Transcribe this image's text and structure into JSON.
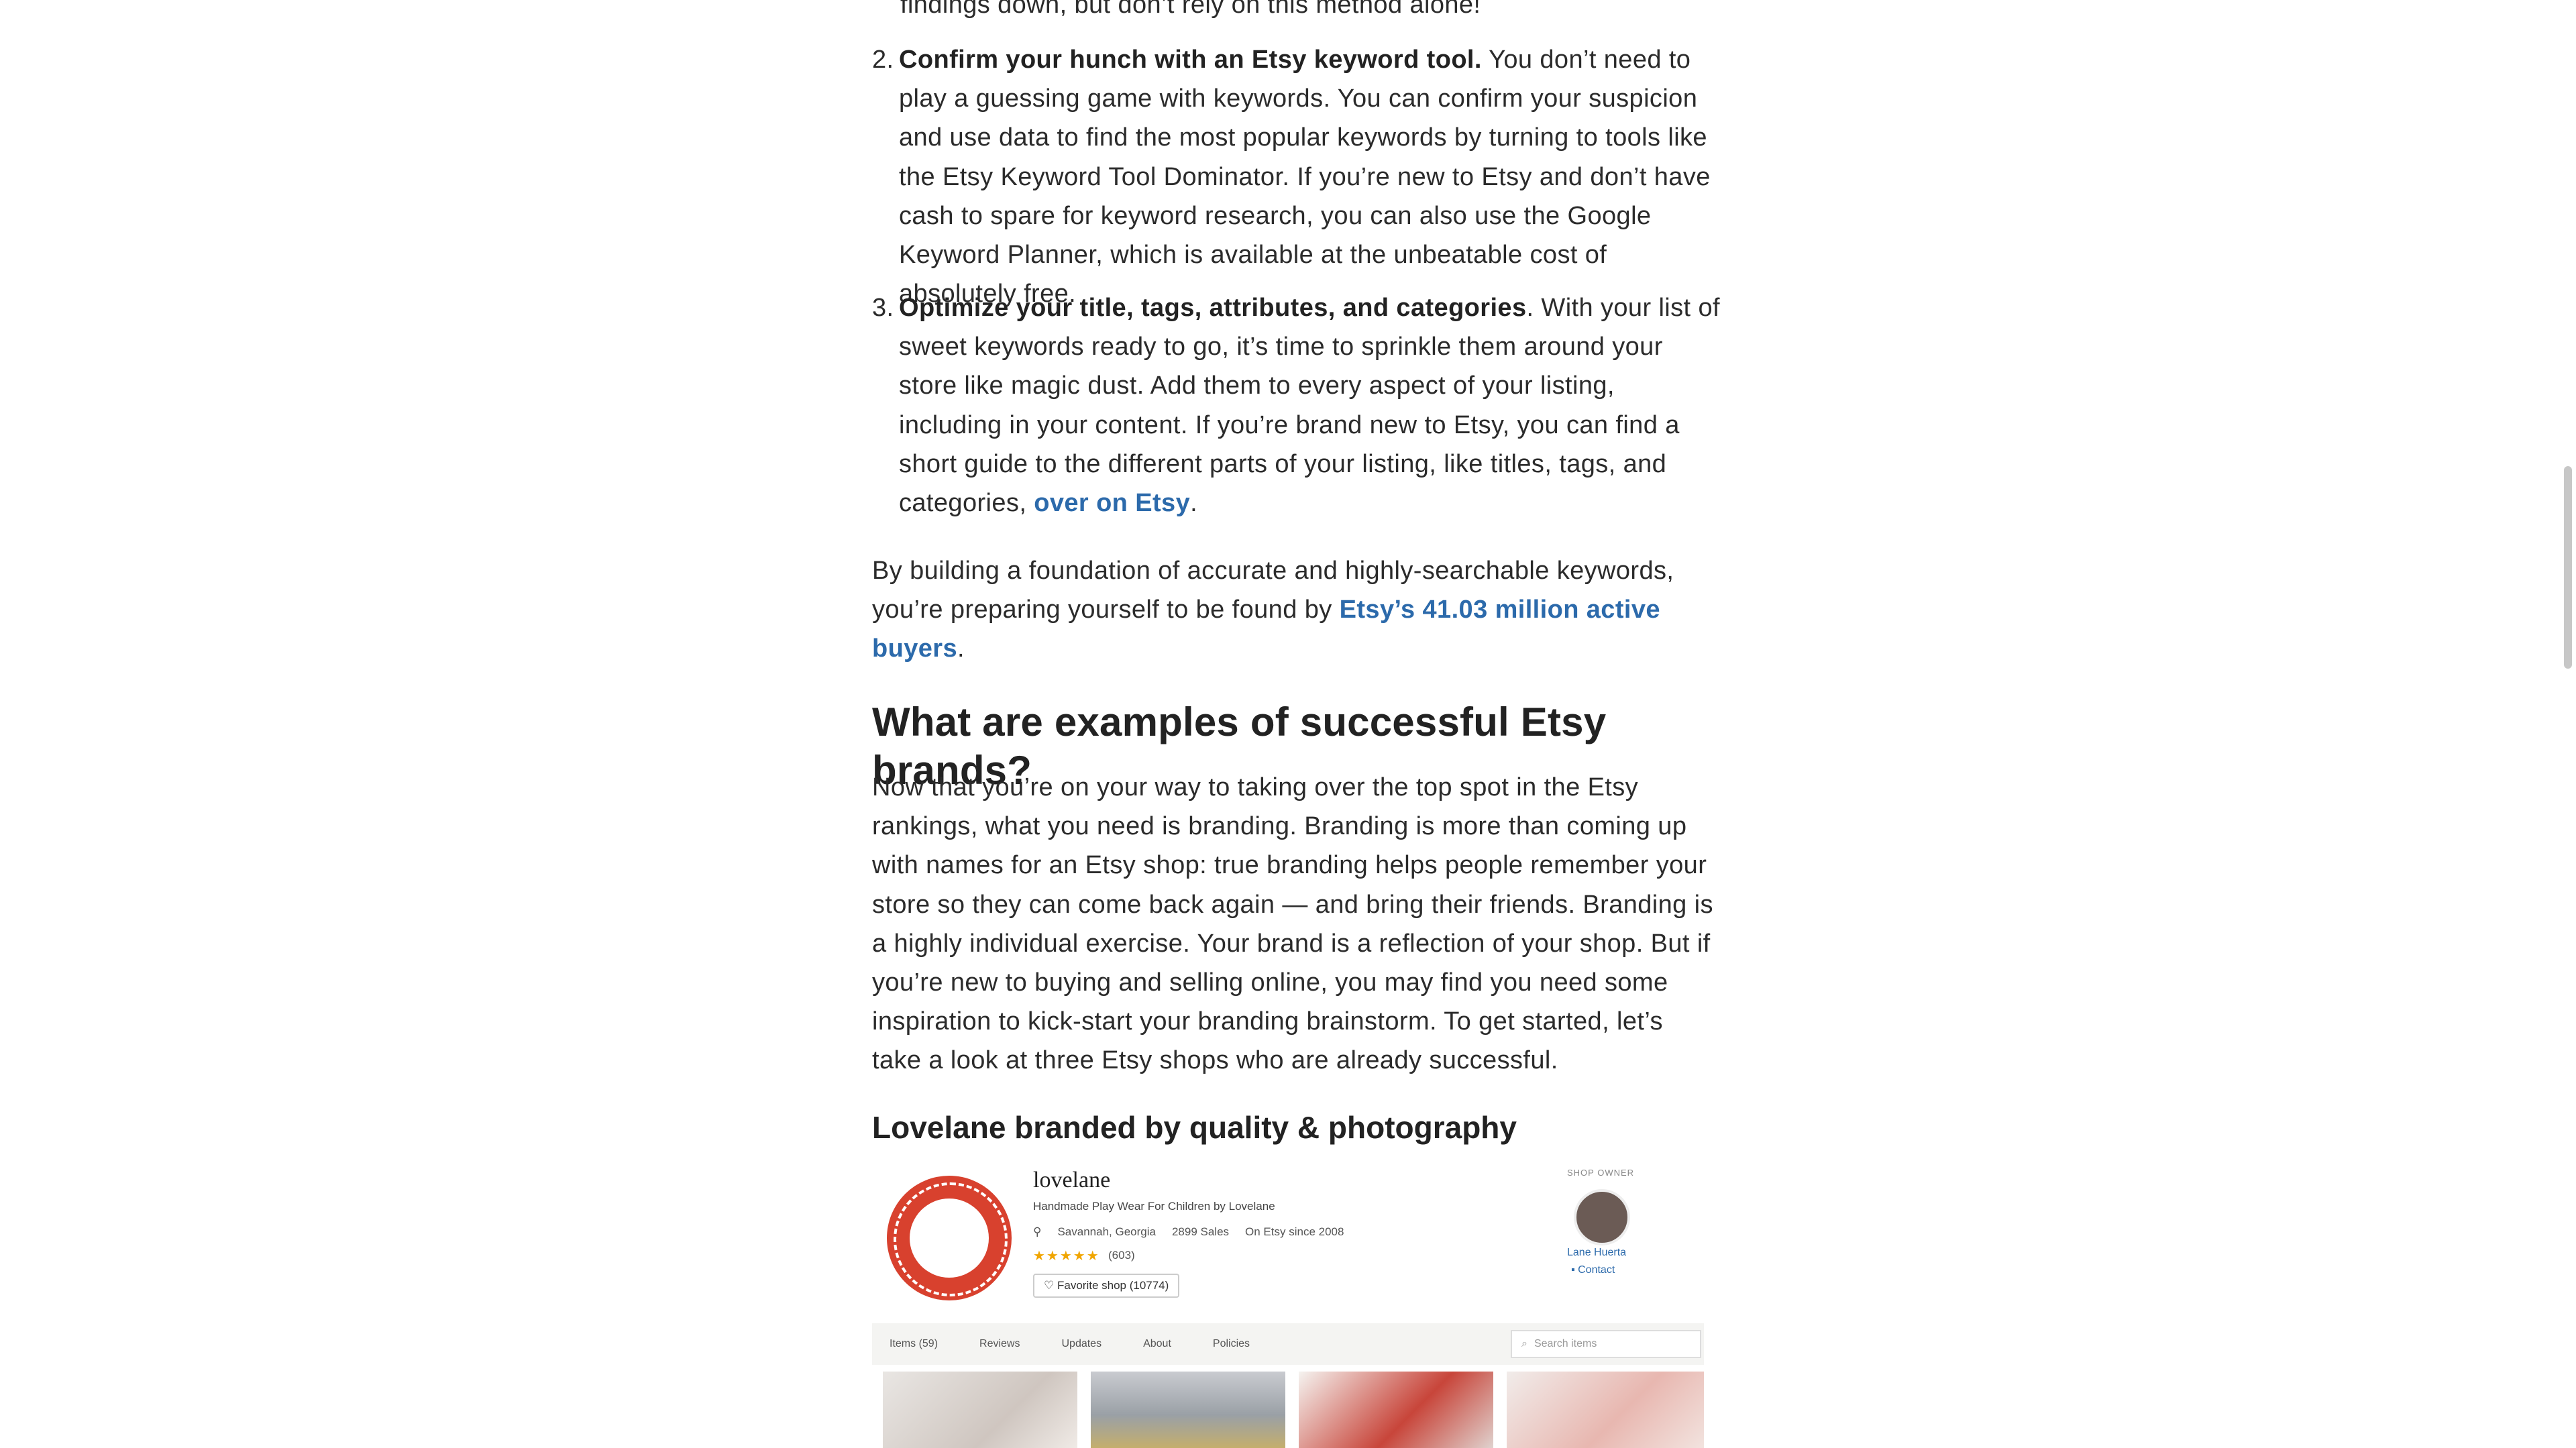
{
  "article": {
    "top_fragment": "findings down, but don’t rely on this method alone!",
    "list": [
      {
        "number": "2.",
        "bold": "Confirm your hunch with an Etsy keyword tool.",
        "text": " You don’t need to play a guessing game with keywords. You can confirm your suspicion and use data to find the most popular keywords by turning to tools like the Etsy Keyword Tool Dominator. If you’re new to Etsy and don’t have cash to spare for keyword research, you can also use the Google Keyword Planner, which is available at the unbeatable cost of absolutely free."
      },
      {
        "number": "3.",
        "bold": "Optimize your title, tags, attributes, and categories",
        "text": ". With your list of sweet keywords ready to go, it’s time to sprinkle them around your store like magic dust. Add them to every aspect of your listing, including in your content. If you’re brand new to Etsy, you can find a short guide to the different parts of your listing, like titles, tags, and categories, ",
        "link": "over on Etsy",
        "tail": "."
      }
    ],
    "para1": {
      "text": "By building a foundation of accurate and highly-searchable keywords, you’re preparing yourself to be found by ",
      "link": "Etsy’s 41.03 million active buyers",
      "tail": "."
    },
    "heading": "What are examples of successful Etsy brands?",
    "para2": "Now that you’re on your way to taking over the top spot in the Etsy rankings, what you need is branding. Branding is more than coming up with names for an Etsy shop: true branding helps people remember your store so they can come back again — and bring their friends. Branding is a highly individual exercise. Your brand is a reflection of your shop. But if you’re new to buying and selling online, you may find you need some inspiration to kick-start your branding brainstorm. To get started, let’s take a look at three Etsy shops who are already successful.",
    "subheading": "Lovelane branded by quality & photography"
  },
  "shop_image": {
    "shop_name": "lovelane",
    "tagline": "Handmade Play Wear For Children by Lovelane",
    "location": "Savannah, Georgia",
    "sales": "2899 Sales",
    "since": "On Etsy since 2008",
    "rating_count": "(603)",
    "stars": "★★★★★",
    "favorite": "Favorite shop (10774)",
    "owner_label": "SHOP OWNER",
    "owner_name": "Lane Huerta",
    "contact": "Contact",
    "tabs": [
      "Items (59)",
      "Reviews",
      "Updates",
      "About",
      "Policies"
    ],
    "search_placeholder": "Search items",
    "colors": {
      "logo_red": "#d8412e",
      "link_blue": "#2c6aab"
    }
  }
}
